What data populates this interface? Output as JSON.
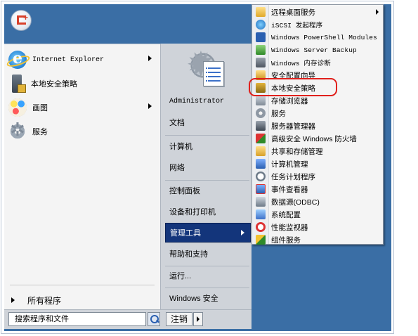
{
  "colors": {
    "desktop": "#3a6ea5",
    "active_item": "#13357b",
    "annotation_ring": "#e0201c"
  },
  "header": {
    "user_icon": "user-tile-icon"
  },
  "left_pane": {
    "items": [
      {
        "label": "Internet Explorer",
        "icon": "internet-explorer-icon",
        "has_submenu": true
      },
      {
        "label": "本地安全策略",
        "icon": "local-security-policy-icon",
        "has_submenu": false
      },
      {
        "label": "画图",
        "icon": "paint-icon",
        "has_submenu": true
      },
      {
        "label": "服务",
        "icon": "services-icon",
        "has_submenu": false
      }
    ],
    "all_programs": "所有程序"
  },
  "right_pane": {
    "top_icon": "admin-tools-icon",
    "items": [
      {
        "label": "Administrator"
      },
      {
        "label": "文档"
      },
      {
        "label": "计算机"
      },
      {
        "label": "网络"
      },
      {
        "label": "控制面板"
      },
      {
        "label": "设备和打印机"
      },
      {
        "label": "管理工具",
        "active": true
      },
      {
        "label": "帮助和支持"
      },
      {
        "label": "运行..."
      },
      {
        "label": "Windows 安全"
      }
    ]
  },
  "bottom": {
    "search_placeholder": "搜索程序和文件",
    "logoff_label": "注销"
  },
  "submenu": {
    "items": [
      {
        "label": "远程桌面服务",
        "icon": "folder-icon",
        "has_submenu": true
      },
      {
        "label": "iSCSI 发起程序",
        "icon": "iscsi-icon"
      },
      {
        "label": "Windows PowerShell Modules",
        "icon": "powershell-icon"
      },
      {
        "label": "Windows Server Backup",
        "icon": "backup-icon"
      },
      {
        "label": "Windows 内存诊断",
        "icon": "memory-diagnostic-icon"
      },
      {
        "label": "安全配置向导",
        "icon": "security-wizard-icon"
      },
      {
        "label": "本地安全策略",
        "icon": "local-security-policy-icon",
        "highlighted": true
      },
      {
        "label": "存储浏览器",
        "icon": "storage-explorer-icon"
      },
      {
        "label": "服务",
        "icon": "services-icon"
      },
      {
        "label": "服务器管理器",
        "icon": "server-manager-icon"
      },
      {
        "label": "高级安全 Windows 防火墙",
        "icon": "firewall-icon"
      },
      {
        "label": "共享和存储管理",
        "icon": "share-storage-icon"
      },
      {
        "label": "计算机管理",
        "icon": "computer-management-icon"
      },
      {
        "label": "任务计划程序",
        "icon": "task-scheduler-icon"
      },
      {
        "label": "事件查看器",
        "icon": "event-viewer-icon"
      },
      {
        "label": "数据源(ODBC)",
        "icon": "odbc-icon"
      },
      {
        "label": "系统配置",
        "icon": "system-config-icon"
      },
      {
        "label": "性能监视器",
        "icon": "performance-monitor-icon"
      },
      {
        "label": "组件服务",
        "icon": "component-services-icon"
      }
    ]
  }
}
